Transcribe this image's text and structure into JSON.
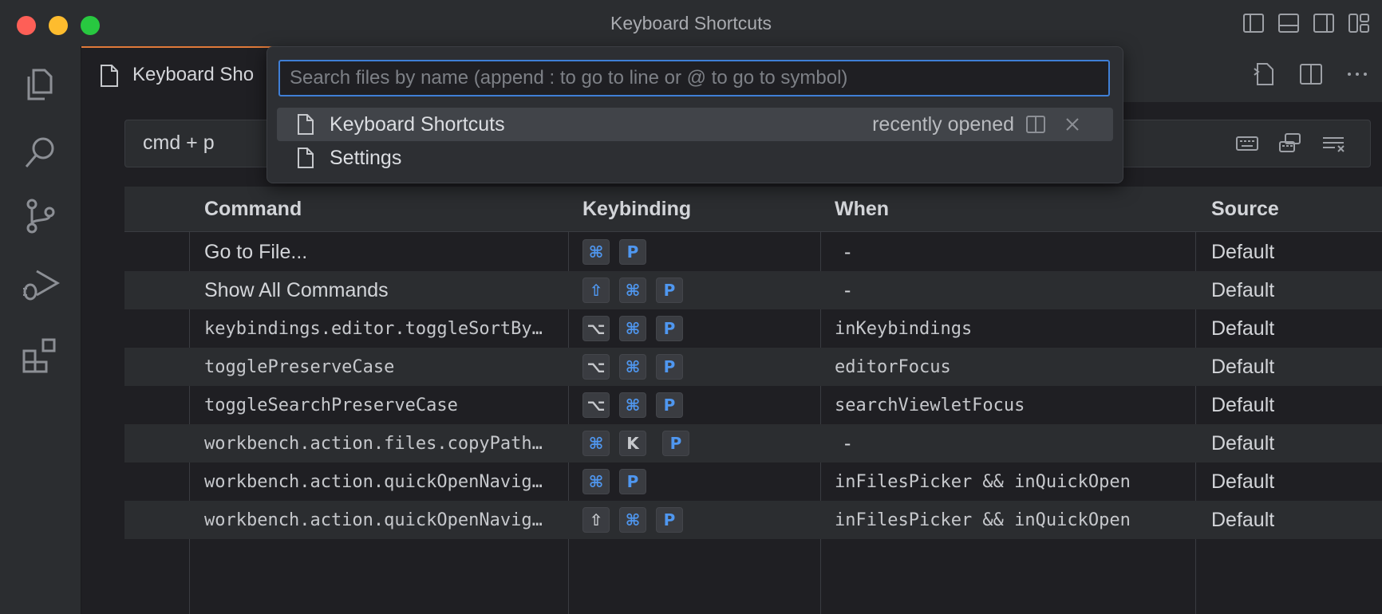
{
  "window": {
    "title": "Keyboard Shortcuts"
  },
  "tab": {
    "label": "Keyboard Sho"
  },
  "search": {
    "value": "cmd + p"
  },
  "quick_open": {
    "placeholder": "Search files by name (append : to go to line or @ to go to symbol)",
    "items": [
      {
        "label": "Keyboard Shortcuts",
        "description": "recently opened"
      },
      {
        "label": "Settings",
        "description": ""
      }
    ]
  },
  "table": {
    "headers": {
      "command": "Command",
      "keybinding": "Keybinding",
      "when": "When",
      "source": "Source"
    },
    "rows": [
      {
        "command": "Go to File...",
        "keys": [
          "⌘",
          "P"
        ],
        "when": "-",
        "source": "Default"
      },
      {
        "command": "Show All Commands",
        "keys": [
          "⇧",
          "⌘",
          "P"
        ],
        "when": "-",
        "source": "Default"
      },
      {
        "command": "keybindings.editor.toggleSortBy…",
        "keys": [
          "⌥",
          "⌘",
          "P"
        ],
        "when": "inKeybindings",
        "source": "Default"
      },
      {
        "command": "togglePreserveCase",
        "keys": [
          "⌥",
          "⌘",
          "P"
        ],
        "when": "editorFocus",
        "source": "Default"
      },
      {
        "command": "toggleSearchPreserveCase",
        "keys": [
          "⌥",
          "⌘",
          "P"
        ],
        "when": "searchViewletFocus",
        "source": "Default"
      },
      {
        "command": "workbench.action.files.copyPath…",
        "keys": [
          "⌘",
          "K",
          "P"
        ],
        "when": "-",
        "source": "Default"
      },
      {
        "command": "workbench.action.quickOpenNavig…",
        "keys": [
          "⌘",
          "P"
        ],
        "when": "inFilesPicker && inQuickOpen",
        "source": "Default"
      },
      {
        "command": "workbench.action.quickOpenNavig…",
        "keys": [
          "⇧",
          "⌘",
          "P"
        ],
        "when": "inFilesPicker && inQuickOpen",
        "source": "Default"
      }
    ]
  },
  "colors": {
    "accent": "#3f7fd6",
    "key_accent": "#4f97f0",
    "tab_border": "#e07a3a"
  },
  "icons": {
    "activity": [
      "explorer-icon",
      "search-icon",
      "source-control-icon",
      "run-debug-icon",
      "extensions-icon"
    ],
    "layout": [
      "toggle-primary-sidebar-icon",
      "toggle-panel-icon",
      "toggle-secondary-sidebar-icon",
      "customize-layout-icon"
    ]
  }
}
